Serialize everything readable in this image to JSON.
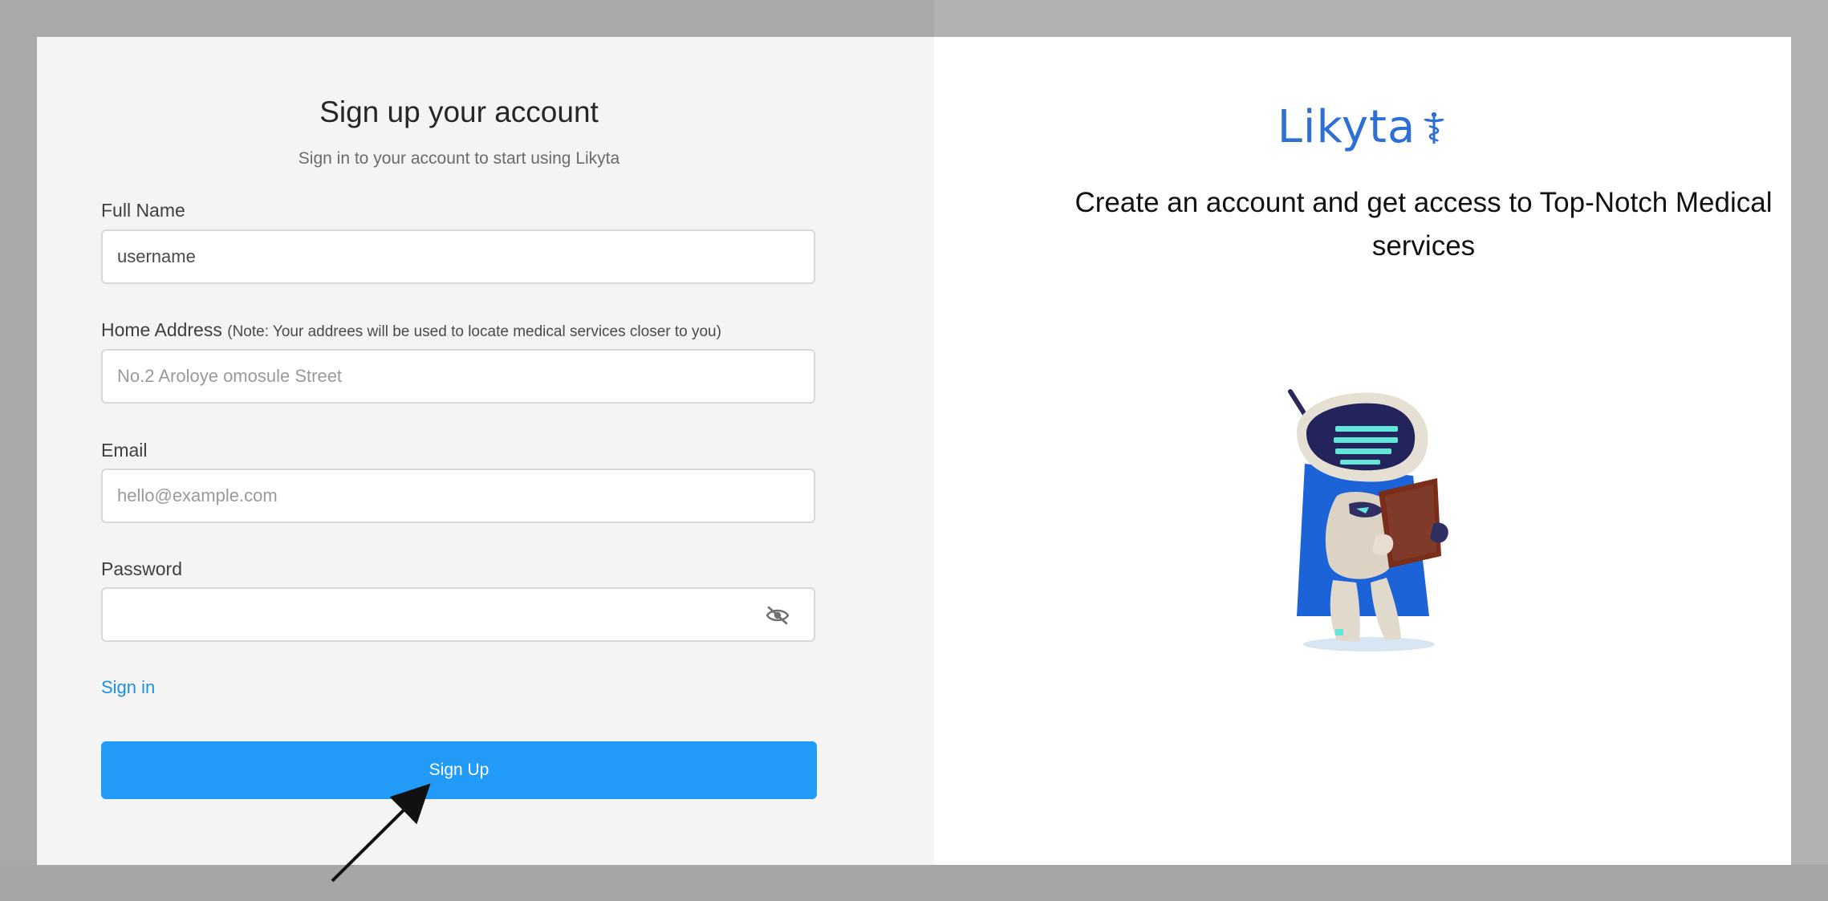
{
  "form": {
    "title": "Sign up your account",
    "subtitle": "Sign in to your account to start using Likyta",
    "full_name": {
      "label": "Full Name",
      "value": "username"
    },
    "home_address": {
      "label": "Home Address",
      "note": "(Note: Your addrees will be used to locate medical services closer to you)",
      "placeholder": "No.2 Aroloye omosule Street"
    },
    "email": {
      "label": "Email",
      "placeholder": "hello@example.com"
    },
    "password": {
      "label": "Password",
      "value": "",
      "toggle_icon": "eye-off-icon"
    },
    "sign_in_link": "Sign in",
    "submit_label": "Sign Up"
  },
  "promo": {
    "brand": "Likyta",
    "brand_icon": "caduceus-icon",
    "headline": "Create an account and get access to Top-Notch Medical services",
    "illustration": "robot-reading-clipboard"
  },
  "colors": {
    "accent": "#219bf7",
    "link": "#1e8fe1",
    "brand": "#2e6fd6"
  }
}
